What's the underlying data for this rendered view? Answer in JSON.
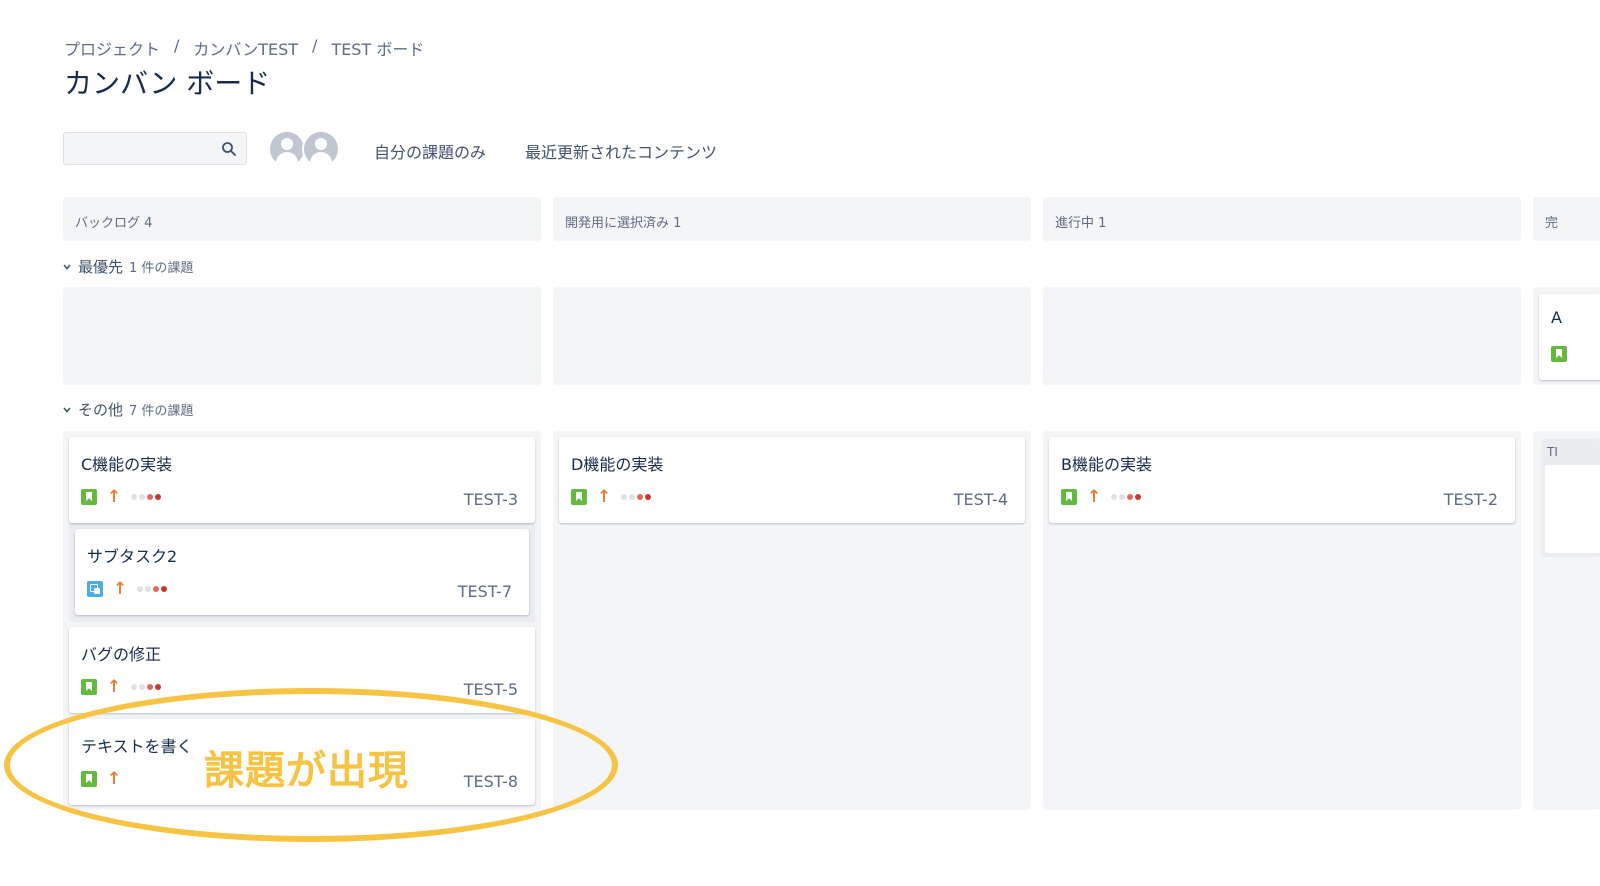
{
  "breadcrumb": {
    "items": [
      "プロジェクト",
      "カンバンTEST",
      "TEST ボード"
    ],
    "separator": "/"
  },
  "page_title": "カンバン ボード",
  "search": {
    "placeholder": "",
    "value": ""
  },
  "filters": {
    "my_issues": "自分の課題のみ",
    "recently_updated": "最近更新されたコンテンツ"
  },
  "columns": [
    {
      "name": "バックログ",
      "count": "4"
    },
    {
      "name": "開発用に選択済み",
      "count": "1"
    },
    {
      "name": "進行中",
      "count": "1"
    },
    {
      "name": "完",
      "count": ""
    }
  ],
  "swimlanes": [
    {
      "name": "最優先",
      "count_label": "1 件の課題"
    },
    {
      "name": "その他",
      "count_label": "7 件の課題"
    }
  ],
  "cards": {
    "c3": {
      "title": "C機能の実装",
      "key": "TEST-3",
      "type": "story-icon"
    },
    "c7": {
      "title": "サブタスク2",
      "key": "TEST-7",
      "type": "subtask-icon"
    },
    "c5": {
      "title": "バグの修正",
      "key": "TEST-5",
      "type": "story-icon"
    },
    "c8": {
      "title": "テキストを書く",
      "key": "TEST-8",
      "type": "story-icon"
    },
    "c4": {
      "title": "D機能の実装",
      "key": "TEST-4",
      "type": "story-icon"
    },
    "c2": {
      "title": "B機能の実装",
      "key": "TEST-2",
      "type": "story-icon"
    }
  },
  "partial_col4": {
    "lane1_letter": "A",
    "lane2_letter": "TI"
  },
  "annotation": {
    "text": "課題が出現"
  },
  "colors": {
    "story": "#63ba3c",
    "subtask": "#4bade8",
    "priority_high": "#e97f33",
    "dot_light": "#dfe1e6",
    "dot_mid": "#de6c5c",
    "dot_dark": "#c9372c",
    "annotation": "#f6c342",
    "column_bg": "#f4f5f7"
  }
}
